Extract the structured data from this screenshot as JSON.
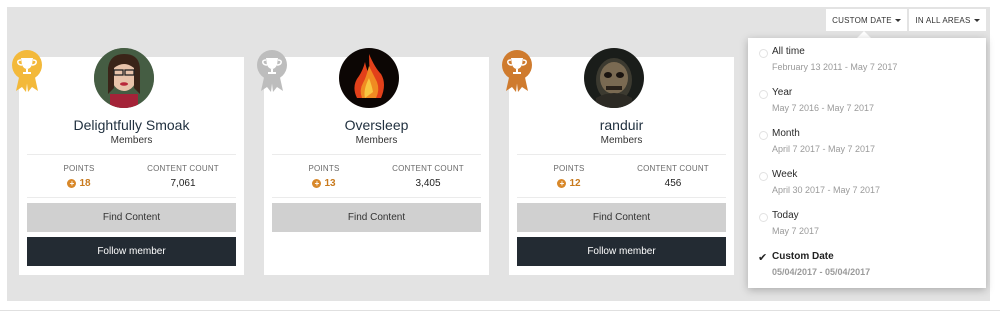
{
  "filters": {
    "date_label": "CUSTOM DATE",
    "area_label": "IN ALL AREAS"
  },
  "members": [
    {
      "name": "Delightfully Smoak",
      "group": "Members",
      "points_label": "POINTS",
      "points": "18",
      "count_label": "CONTENT COUNT",
      "count": "7,061",
      "find_label": "Find Content",
      "follow_label": "Follow member",
      "badge": "gold"
    },
    {
      "name": "Oversleep",
      "group": "Members",
      "points_label": "POINTS",
      "points": "13",
      "count_label": "CONTENT COUNT",
      "count": "3,405",
      "find_label": "Find Content",
      "badge": "silver"
    },
    {
      "name": "randuir",
      "group": "Members",
      "points_label": "POINTS",
      "points": "12",
      "count_label": "CONTENT COUNT",
      "count": "456",
      "find_label": "Find Content",
      "follow_label": "Follow member",
      "badge": "bronze"
    }
  ],
  "badge_colors": {
    "gold": "#f3b93a",
    "silver": "#bdbdbd",
    "bronze": "#cf7b2e"
  },
  "dropdown": {
    "options": [
      {
        "title": "All time",
        "range": "February 13 2011 - May 7 2017"
      },
      {
        "title": "Year",
        "range": "May 7 2016 - May 7 2017"
      },
      {
        "title": "Month",
        "range": "April 7 2017 - May 7 2017"
      },
      {
        "title": "Week",
        "range": "April 30 2017 - May 7 2017"
      },
      {
        "title": "Today",
        "range": "May 7 2017"
      },
      {
        "title": "Custom Date",
        "range": "05/04/2017 - 05/04/2017",
        "selected": true
      }
    ]
  }
}
